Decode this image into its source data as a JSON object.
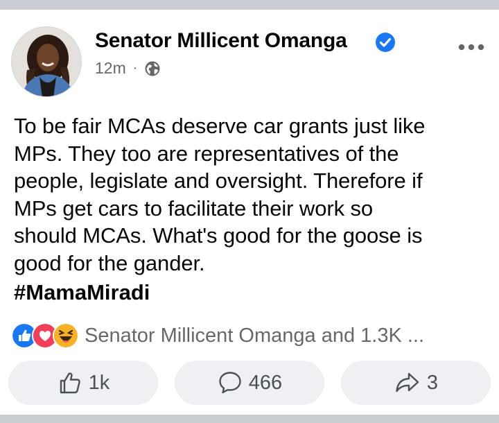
{
  "post": {
    "author": "Senator Millicent Omanga",
    "time": "12m",
    "separator": "·",
    "audience_icon": "globe-icon",
    "verified_icon": "verified-badge-icon",
    "more_icon": "more-options-icon",
    "text_lines": [
      "To be fair MCAs deserve car grants just like",
      "MPs. They too are representatives of the",
      "people, legislate and oversight. Therefore if",
      "MPs get cars to facilitate their work so",
      "should MCAs. What's good for the goose is",
      "good for the gander."
    ],
    "hashtag": "#MamaMiradi"
  },
  "reactions": {
    "icons": [
      "like-reaction-icon",
      "love-reaction-icon",
      "haha-reaction-icon"
    ],
    "summary": "Senator Millicent Omanga and 1.3K ..."
  },
  "actions": {
    "like_count": "1k",
    "comment_count": "466",
    "share_count": "3"
  },
  "colors": {
    "verified": "#1877f2",
    "like": "#1877f2",
    "love": "#f33e58",
    "haha": "#f7b125",
    "secondary_text": "#65676b",
    "button_bg": "#eef0f3"
  }
}
